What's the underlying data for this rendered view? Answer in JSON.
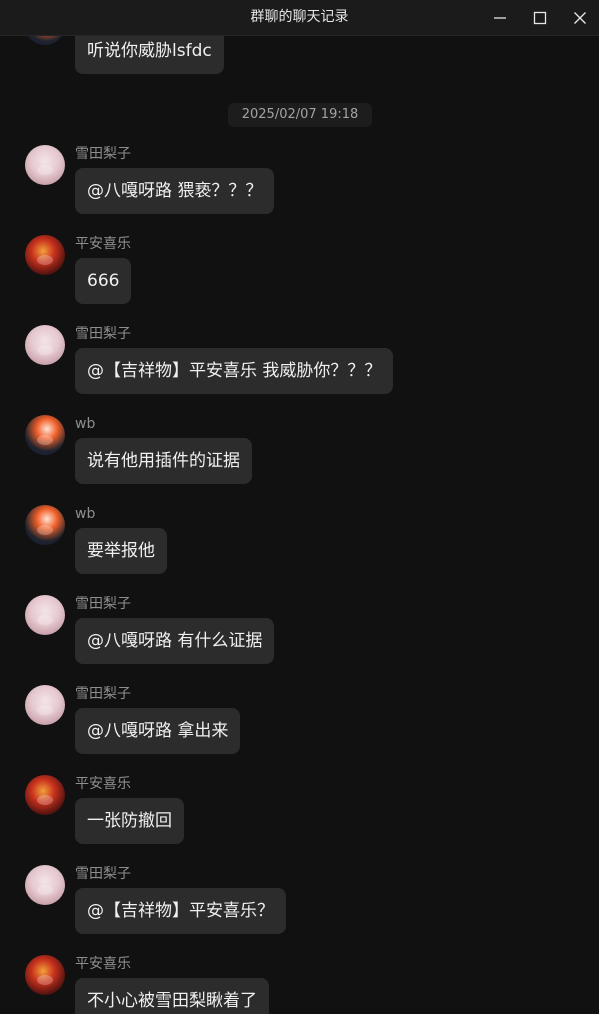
{
  "window": {
    "title": "群聊的聊天记录"
  },
  "timestamp": "2025/02/07 19:18",
  "first_message": {
    "text": "听说你威胁lsfdc"
  },
  "messages": [
    {
      "sender": "雪田梨子",
      "text": "@八嘎呀路 猥亵？？？"
    },
    {
      "sender": "平安喜乐",
      "text": "666"
    },
    {
      "sender": "雪田梨子",
      "text": "@【吉祥物】平安喜乐 我威胁你？？？"
    },
    {
      "sender": "wb",
      "text": "说有他用插件的证据"
    },
    {
      "sender": "wb",
      "text": "要举报他"
    },
    {
      "sender": "雪田梨子",
      "text": "@八嘎呀路 有什么证据"
    },
    {
      "sender": "雪田梨子",
      "text": "@八嘎呀路 拿出来"
    },
    {
      "sender": "平安喜乐",
      "text": "一张防撤回"
    },
    {
      "sender": "雪田梨子",
      "text": "@【吉祥物】平安喜乐？"
    },
    {
      "sender": "平安喜乐",
      "text": "不小心被雪田梨瞅着了"
    }
  ],
  "icons": {
    "minimize": "minimize-icon",
    "maximize": "maximize-icon",
    "close": "close-icon"
  }
}
